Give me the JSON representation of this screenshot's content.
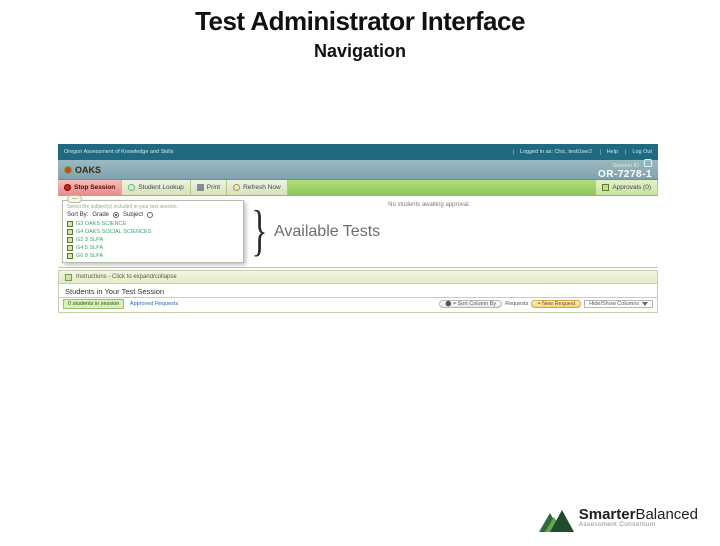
{
  "slide": {
    "title": "Test Administrator Interface",
    "subtitle": "Navigation"
  },
  "topbar": {
    "left": "Oregon Assessment of Knowledge and Skills",
    "logged": "Logged in as: Chic, testUser2",
    "help": "Help",
    "logout": "Log Out"
  },
  "header": {
    "logo": "OAKS",
    "session_label": "Session ID",
    "session_value": "OR-7278-1"
  },
  "toolbar": {
    "stop": "Stop Session",
    "lookup": "Student Lookup",
    "print": "Print",
    "refresh": "Refresh Now",
    "approvals": "Approvals (0)"
  },
  "panel": {
    "collapse": "—",
    "hint": "Select the subject(s) included in your test session.",
    "sort_label": "Sort By:",
    "sort_grade": "Grade",
    "sort_subject": "Subject",
    "tests": [
      "G3 OAKS SCIENCE",
      "G4 OAKS SOCIAL SCIENCES",
      "G2 3 SLPA",
      "G4 5 SLPA",
      "G6 8 SLPA"
    ]
  },
  "callout": "Available Tests",
  "approval_area": "No students awaiting approval.",
  "instructions": "Instructions - Click to expand/collapse",
  "session_students": {
    "heading": "Students in Your Test Session",
    "count_btn": "students in session",
    "approved_link": "Approved Requests",
    "sort_by": "= Sort Column By",
    "requests": "Requests",
    "new_request": "= New Request",
    "hide_show": "Hide/Show Columns"
  },
  "brand": {
    "line1a": "Smarter",
    "line1b": "Balanced",
    "line2": "Assessment Consortium"
  }
}
